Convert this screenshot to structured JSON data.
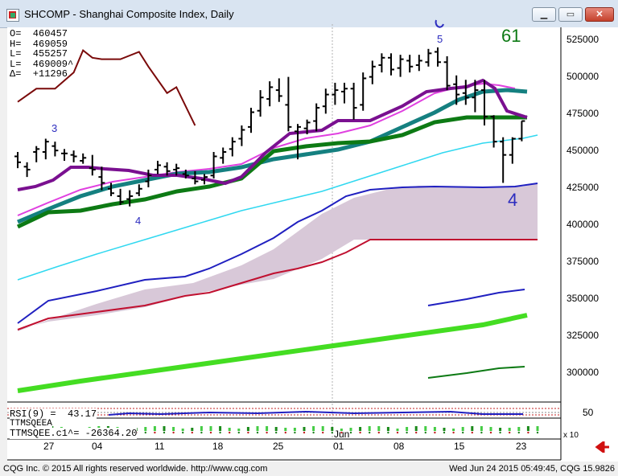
{
  "window": {
    "title": "SHCOMP - Shanghai Composite Index, Daily"
  },
  "readout": {
    "open": "O=  460457",
    "high": "H=  469059",
    "low": "L=  455257",
    "last": "L=  469009^",
    "delta": "Δ=  +11296"
  },
  "price_axis": {
    "labels": [
      "525000",
      "500000",
      "475000",
      "450000",
      "425000",
      "400000",
      "375000",
      "350000",
      "325000",
      "300000"
    ]
  },
  "date_axis": {
    "labels": [
      "27",
      "04",
      "11",
      "18",
      "25",
      "01",
      "08",
      "15",
      "23"
    ],
    "month_label": "Jun",
    "multiplier": "x 10"
  },
  "annotations": {
    "wave3": "3",
    "wave4_left": "4",
    "wave5": "5",
    "wave4_right": "4",
    "count": "61"
  },
  "panels": {
    "rsi_label": "RSI(9) =  43.17",
    "rsi_tick": "50",
    "ttm_label_top": "TTMSQEEA",
    "ttm_label": "TTMSQEE.c1^= -26364.20"
  },
  "status": {
    "copyright": "CQG Inc. © 2015 All rights reserved worldwide. http://www.cqg.com",
    "timestamp": "Wed Jun 24 2015 05:49:45, CQG 15.9826"
  },
  "colors": {
    "ma_short": "#7a1090",
    "ma_teal": "#158080",
    "ma_green": "#0d7a14",
    "ma_magenta": "#e040e0",
    "ma_cyan": "#30d8f0",
    "band_upper": "#2020c0",
    "band_lower": "#c01030",
    "trend_lime": "#44dd22",
    "dark_red": "#7a0a0a"
  },
  "chart_data": {
    "type": "bar",
    "title": "SHCOMP - Shanghai Composite Index, Daily",
    "ylim": [
      283500,
      539500
    ],
    "price_scale_multiplier": "x 10",
    "ohlc": [
      [
        0,
        445000,
        448000,
        437000,
        441000
      ],
      [
        1,
        438000,
        441000,
        431000,
        436000
      ],
      [
        2,
        448000,
        452000,
        441000,
        450000
      ],
      [
        3,
        448000,
        457000,
        443000,
        455000
      ],
      [
        4,
        452000,
        455000,
        445000,
        449000
      ],
      [
        5,
        447000,
        450000,
        442000,
        447000
      ],
      [
        6,
        446000,
        449000,
        441000,
        445000
      ],
      [
        7,
        442000,
        447000,
        440000,
        444000
      ],
      [
        8,
        437000,
        446000,
        432000,
        436000
      ],
      [
        9,
        431000,
        438000,
        422000,
        427000
      ],
      [
        10,
        423000,
        427000,
        418000,
        420000
      ],
      [
        11,
        418000,
        423000,
        412000,
        414000
      ],
      [
        12,
        416000,
        422000,
        411000,
        418000
      ],
      [
        13,
        420000,
        426000,
        418000,
        423000
      ],
      [
        14,
        428000,
        436000,
        424000,
        432000
      ],
      [
        15,
        436000,
        442000,
        433000,
        439000
      ],
      [
        16,
        438000,
        441000,
        432000,
        435000
      ],
      [
        17,
        436000,
        440000,
        432000,
        437000
      ],
      [
        18,
        433000,
        436000,
        430000,
        432000
      ],
      [
        19,
        430000,
        435000,
        426000,
        428000
      ],
      [
        20,
        429000,
        433000,
        426000,
        431000
      ],
      [
        21,
        432000,
        448000,
        430000,
        445000
      ],
      [
        22,
        444000,
        451000,
        440000,
        448000
      ],
      [
        23,
        450000,
        458000,
        445000,
        455000
      ],
      [
        24,
        457000,
        466000,
        452000,
        463000
      ],
      [
        25,
        465000,
        478000,
        461000,
        475000
      ],
      [
        26,
        476000,
        490000,
        472000,
        485000
      ],
      [
        27,
        484000,
        496000,
        479000,
        492000
      ],
      [
        28,
        490000,
        498000,
        482000,
        486000
      ],
      [
        29,
        480000,
        499000,
        462000,
        465000
      ],
      [
        30,
        462000,
        467000,
        443000,
        465000
      ],
      [
        31,
        464000,
        470000,
        460000,
        468000
      ],
      [
        32,
        469000,
        481000,
        462000,
        478000
      ],
      [
        33,
        479000,
        491000,
        474000,
        487000
      ],
      [
        34,
        487000,
        495000,
        480000,
        490000
      ],
      [
        35,
        489000,
        495000,
        481000,
        491000
      ],
      [
        36,
        491000,
        495000,
        470000,
        478000
      ],
      [
        37,
        480000,
        502000,
        476000,
        498000
      ],
      [
        38,
        499000,
        510000,
        494000,
        506000
      ],
      [
        39,
        507000,
        515000,
        502000,
        512000
      ],
      [
        40,
        512000,
        515000,
        500000,
        504000
      ],
      [
        41,
        505000,
        514000,
        499000,
        511000
      ],
      [
        42,
        510000,
        514000,
        502000,
        506000
      ],
      [
        43,
        507000,
        514000,
        503000,
        510000
      ],
      [
        44,
        509000,
        518000,
        506000,
        515000
      ],
      [
        45,
        516000,
        519000,
        506000,
        509000
      ],
      [
        46,
        509000,
        513000,
        490000,
        493000
      ],
      [
        47,
        494000,
        500000,
        480000,
        487000
      ],
      [
        48,
        488000,
        497000,
        480000,
        485000
      ],
      [
        49,
        485000,
        497000,
        475000,
        490000
      ],
      [
        50,
        490000,
        497000,
        466000,
        472000
      ],
      [
        51,
        472000,
        473000,
        451000,
        455000
      ],
      [
        52,
        455000,
        458000,
        427000,
        446000
      ],
      [
        53,
        446000,
        458000,
        440000,
        457000
      ],
      [
        54,
        457000,
        469059,
        455257,
        469009
      ]
    ],
    "dark_red_line": {
      "x": [
        0,
        2,
        4,
        6,
        7,
        8,
        9,
        11,
        13,
        14,
        16,
        17,
        19
      ],
      "y": [
        482000,
        491000,
        491000,
        502000,
        517000,
        512000,
        511000,
        511000,
        516000,
        506000,
        488000,
        492000,
        466000
      ]
    }
  }
}
